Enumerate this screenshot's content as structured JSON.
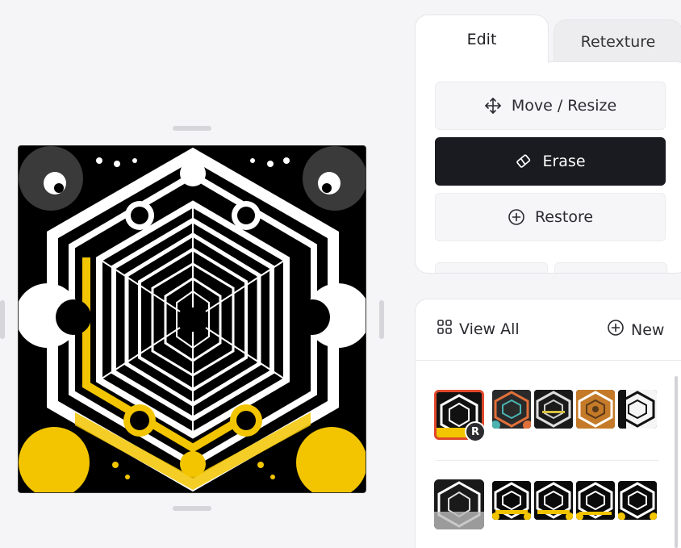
{
  "tabs": {
    "edit": "Edit",
    "retexture": "Retexture"
  },
  "tools": {
    "move_resize": "Move / Resize",
    "erase": "Erase",
    "restore": "Restore"
  },
  "gallery": {
    "view_all": "View All",
    "new": "New",
    "selected_badge": "R"
  },
  "icons": {
    "move": "move-arrows-icon",
    "erase": "eraser-icon",
    "restore": "plus-circle-icon",
    "view_all": "grid-icon",
    "new": "plus-circle-icon"
  },
  "colors": {
    "accent_dark": "#1a1b20",
    "selection": "#e0482b",
    "art_yellow": "#f2c500"
  }
}
